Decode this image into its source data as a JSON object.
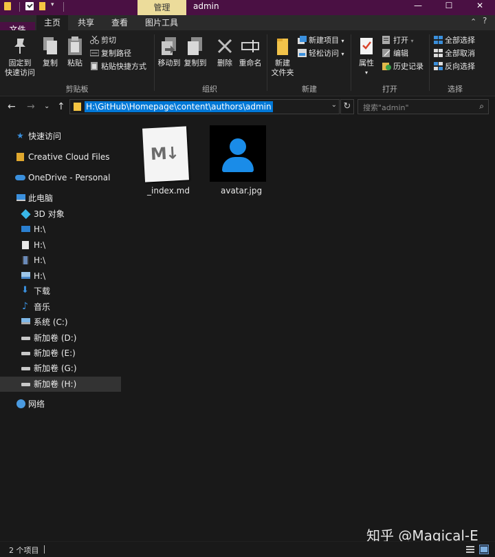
{
  "titlebar": {
    "context_tab": "管理",
    "title": "admin",
    "minimize": "—",
    "maximize": "☐",
    "close": "✕"
  },
  "ribbon_tabs": [
    "文件",
    "主页",
    "共享",
    "查看",
    "图片工具"
  ],
  "ribbon": {
    "clipboard": {
      "label": "剪贴板",
      "pin": [
        "固定到",
        "快速访问"
      ],
      "copy": "复制",
      "paste": "粘贴",
      "cut": "剪切",
      "copy_path": "复制路径",
      "paste_shortcut": "粘贴快捷方式"
    },
    "organize": {
      "label": "组织",
      "move_to": "移动到",
      "copy_to": "复制到",
      "delete": "删除",
      "rename": "重命名"
    },
    "new": {
      "label": "新建",
      "new_folder": [
        "新建",
        "文件夹"
      ],
      "new_item": "新建项目",
      "easy_access": "轻松访问"
    },
    "open": {
      "label": "打开",
      "properties": "属性",
      "open": "打开",
      "edit": "编辑",
      "history": "历史记录"
    },
    "select": {
      "label": "选择",
      "select_all": "全部选择",
      "select_none": "全部取消",
      "invert": "反向选择"
    }
  },
  "address": {
    "path": "H:\\GitHub\\Homepage\\content\\authors\\admin",
    "search_placeholder": "搜索\"admin\""
  },
  "sidebar": {
    "quick_access": "快速访问",
    "creative_cloud": "Creative Cloud Files",
    "onedrive": "OneDrive - Personal",
    "this_pc": "此电脑",
    "items": [
      "3D 对象",
      "H:\\",
      "H:\\",
      "H:\\",
      "H:\\",
      "下载",
      "音乐",
      "系统 (C:)",
      "新加卷 (D:)",
      "新加卷 (E:)",
      "新加卷 (G:)",
      "新加卷 (H:)"
    ],
    "network": "网络"
  },
  "files": [
    {
      "name": "_index.md",
      "icon": "markdown-icon"
    },
    {
      "name": "avatar.jpg",
      "icon": "avatar-image"
    }
  ],
  "status": {
    "count": "2 个项目"
  },
  "watermark": "知乎 @Magical-E"
}
